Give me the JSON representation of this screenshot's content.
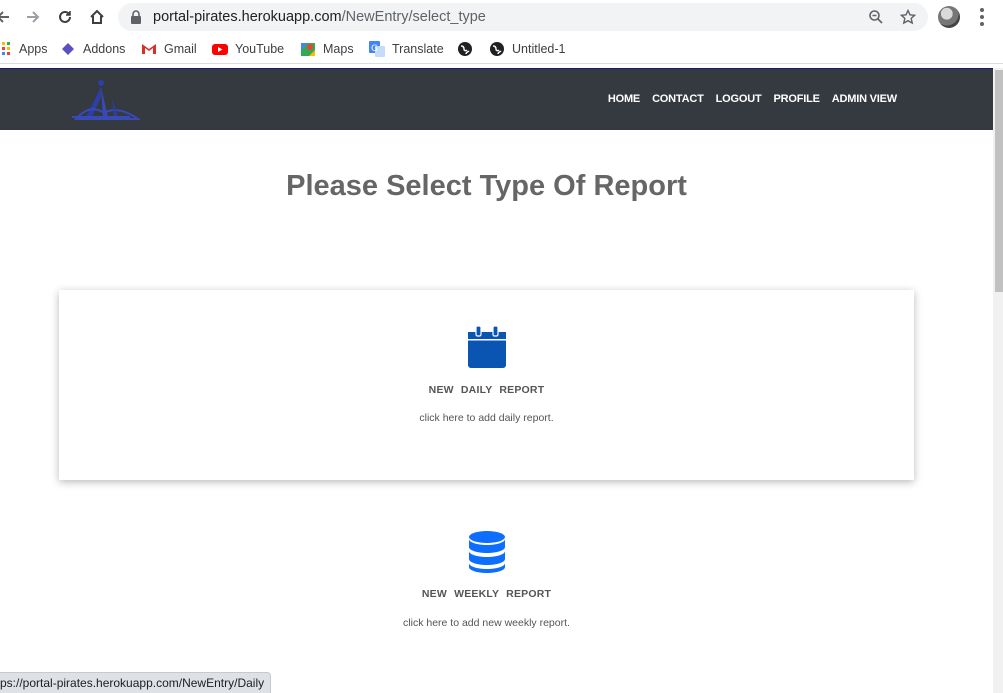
{
  "browser": {
    "url_host": "portal-pirates.herokuapp.com",
    "url_path": "/NewEntry/select_type",
    "bookmarks": [
      {
        "label": "Apps",
        "icon": "apps-grid-icon"
      },
      {
        "label": "Addons",
        "icon": "addons-icon"
      },
      {
        "label": "Gmail",
        "icon": "gmail-icon"
      },
      {
        "label": "YouTube",
        "icon": "youtube-icon"
      },
      {
        "label": "Maps",
        "icon": "maps-icon"
      },
      {
        "label": "Translate",
        "icon": "translate-icon"
      },
      {
        "label": "",
        "icon": "globe-icon"
      },
      {
        "label": "Untitled-1",
        "icon": "globe-icon"
      }
    ],
    "status_text": "ps://portal-pirates.herokuapp.com/NewEntry/Daily"
  },
  "header": {
    "nav": [
      "HOME",
      "CONTACT",
      "LOGOUT",
      "PROFILE",
      "ADMIN VIEW"
    ],
    "bg_color": "#343a40"
  },
  "page": {
    "title": "Please Select Type Of Report",
    "daily": {
      "title": "NEW  DAILY  REPORT",
      "description": "click here to add daily report.",
      "icon": "calendar-icon",
      "icon_color": "#0b55b2"
    },
    "weekly": {
      "title": "NEW  WEEKLY  REPORT",
      "description": "click here to add new weekly report.",
      "icon": "database-icon",
      "icon_color": "#0d6efd"
    }
  }
}
